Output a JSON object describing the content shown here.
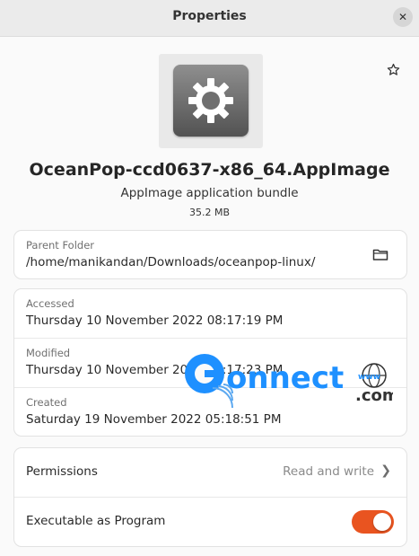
{
  "window": {
    "title": "Properties"
  },
  "file": {
    "name": "OceanPop-ccd0637-x86_64.AppImage",
    "type": "AppImage application bundle",
    "size": "35.2 MB",
    "icon": "gear-icon"
  },
  "location": {
    "label": "Parent Folder",
    "path": "/home/manikandan/Downloads/oceanpop-linux/"
  },
  "dates": [
    {
      "label": "Accessed",
      "value": "Thursday 10 November 2022 08:17:19 PM"
    },
    {
      "label": "Modified",
      "value": "Thursday 10 November 2022 08:17:23 PM"
    },
    {
      "label": "Created",
      "value": "Saturday 19 November 2022 05:18:51 PM"
    }
  ],
  "permissions": {
    "label": "Permissions",
    "value": "Read and write",
    "executable_label": "Executable as Program",
    "executable": true
  },
  "watermark": {
    "text": "Gonnect",
    "suffix": ".com"
  },
  "colors": {
    "accent": "#e95420",
    "watermark": "#1e90ff"
  }
}
